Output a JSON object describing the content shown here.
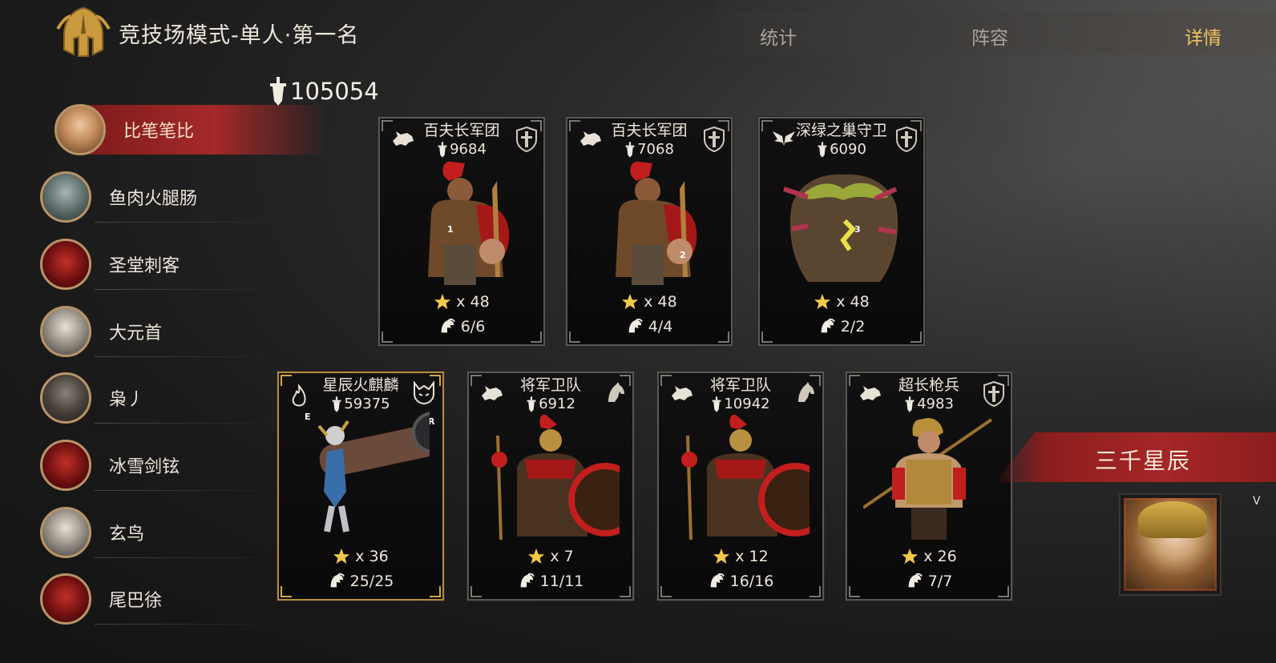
{
  "header": {
    "title": "竞技场模式-单人·第一名",
    "tabs": [
      {
        "label": "统计",
        "active": false
      },
      {
        "label": "阵容",
        "active": false
      },
      {
        "label": "详情",
        "active": true
      }
    ]
  },
  "total_power": "105054",
  "players": [
    {
      "name": "比笔笔比",
      "active": true
    },
    {
      "name": "鱼肉火腿肠",
      "active": false
    },
    {
      "name": "圣堂刺客",
      "active": false
    },
    {
      "name": "大元首",
      "active": false
    },
    {
      "name": "枭丿",
      "active": false
    },
    {
      "name": "冰雪剑铉",
      "active": false
    },
    {
      "name": "玄鸟",
      "active": false
    },
    {
      "name": "尾巴徐",
      "active": false
    }
  ],
  "units_row1": [
    {
      "name": "百夫长军团",
      "power": "9684",
      "stars": "x 48",
      "troops": "6/6",
      "slot": "1"
    },
    {
      "name": "百夫长军团",
      "power": "7068",
      "stars": "x 48",
      "troops": "4/4",
      "slot": "2"
    },
    {
      "name": "深绿之巢守卫",
      "power": "6090",
      "stars": "x 48",
      "troops": "2/2",
      "slot": "3"
    }
  ],
  "units_row2": [
    {
      "name": "星辰火麒麟",
      "power": "59375",
      "stars": "x 36",
      "troops": "25/25",
      "key_e": "E",
      "key_r": "R"
    },
    {
      "name": "将军卫队",
      "power": "6912",
      "stars": "x 7",
      "troops": "11/11"
    },
    {
      "name": "将军卫队",
      "power": "10942",
      "stars": "x 12",
      "troops": "16/16"
    },
    {
      "name": "超长枪兵",
      "power": "4983",
      "stars": "x 26",
      "troops": "7/7"
    }
  ],
  "opponent": {
    "name": "三千星辰",
    "edge_text": "V"
  },
  "colors": {
    "accent_gold": "#f0c460",
    "banner_red": "#a52626",
    "hero_border": "#b58b3c"
  },
  "icons": [
    "helmet-logo-icon",
    "power-sword-icon",
    "star-icon",
    "troop-helmet-icon",
    "wolf-faction-icon",
    "shield-class-icon",
    "horse-class-icon",
    "wings-faction-icon",
    "flame-icon",
    "demon-mask-icon"
  ]
}
